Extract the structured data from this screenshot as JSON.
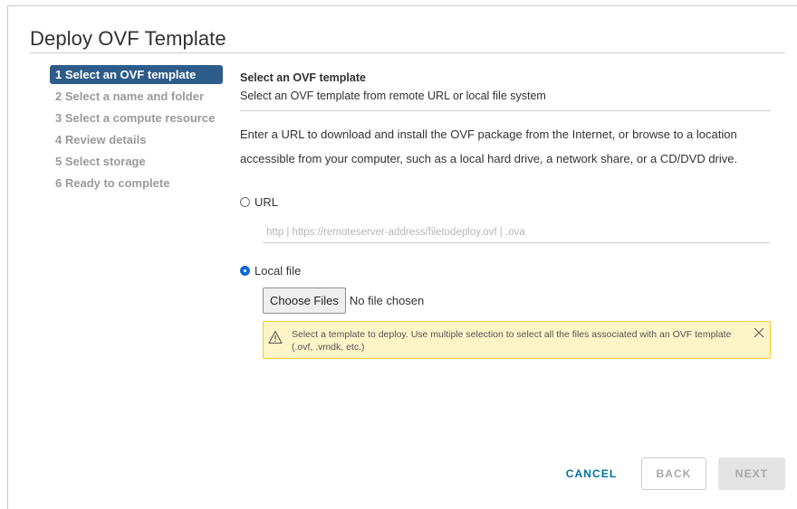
{
  "dialog": {
    "title": "Deploy OVF Template"
  },
  "steps": [
    {
      "label": "1 Select an OVF template",
      "active": true
    },
    {
      "label": "2 Select a name and folder",
      "active": false
    },
    {
      "label": "3 Select a compute resource",
      "active": false
    },
    {
      "label": "4 Review details",
      "active": false
    },
    {
      "label": "5 Select storage",
      "active": false
    },
    {
      "label": "6 Ready to complete",
      "active": false
    }
  ],
  "section": {
    "title": "Select an OVF template",
    "subtitle": "Select an OVF template from remote URL or local file system",
    "description": "Enter a URL to download and install the OVF package from the Internet, or browse to a location accessible from your computer, such as a local hard drive, a network share, or a CD/DVD drive."
  },
  "options": {
    "url_label": "URL",
    "url_placeholder": "http | https://remoteserver-address/filetodeploy.ovf | .ova",
    "url_value": "",
    "local_label": "Local file",
    "selected": "local"
  },
  "file_picker": {
    "button_label": "Choose Files",
    "status": "No file chosen"
  },
  "alert": {
    "icon": "warning-icon",
    "message": "Select a template to deploy. Use multiple selection to select all the files associated with an OVF template (.ovf, .vmdk, etc.)",
    "color_bg": "#fdf4c7",
    "color_border": "#f0cf2e"
  },
  "footer": {
    "cancel_label": "CANCEL",
    "back_label": "BACK",
    "next_label": "NEXT"
  },
  "colors": {
    "accent": "#2e5c8a",
    "link": "#0072a3",
    "radio_checked": "#0c6bd6"
  }
}
